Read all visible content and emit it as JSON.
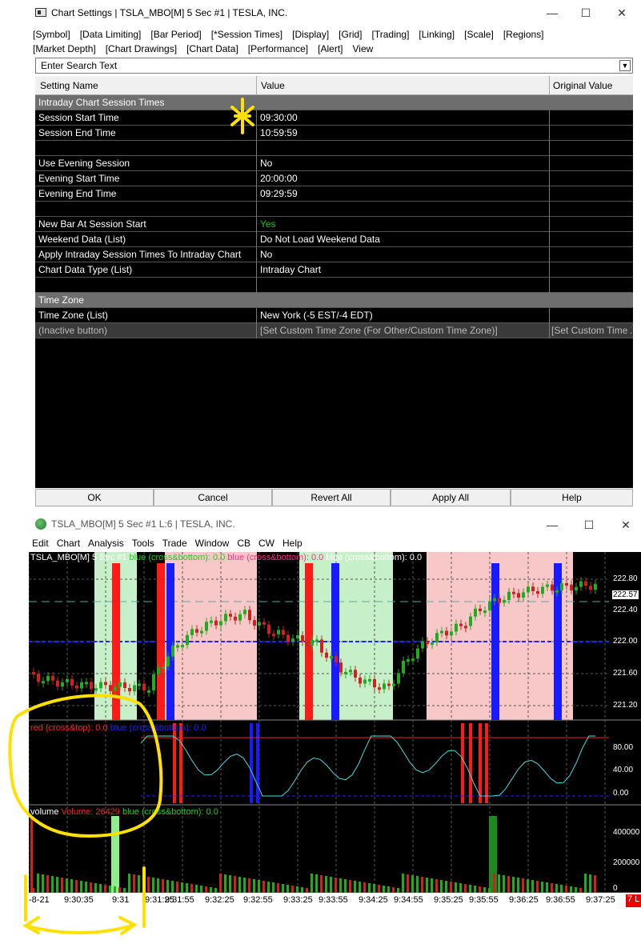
{
  "settings_window": {
    "title": "Chart Settings | TSLA_MBO[M]  5 Sec  #1 | TESLA, INC.",
    "controls": {
      "minimize": "—",
      "maximize": "☐",
      "close": "✕"
    },
    "menu_row1": [
      "[Symbol]",
      "[Data Limiting]",
      "[Bar Period]",
      "[*Session Times]",
      "[Display]",
      "[Grid]",
      "[Trading]",
      "[Linking]",
      "[Scale]",
      "[Regions]"
    ],
    "menu_row2": [
      "[Market Depth]",
      "[Chart Drawings]",
      "[Chart Data]",
      "[Performance]",
      "[Alert]",
      "View"
    ],
    "search_placeholder": "Enter Search Text",
    "columns": {
      "name": "Setting Name",
      "value": "Value",
      "original": "Original Value"
    },
    "rows": [
      {
        "name": "Intraday Chart Session Times",
        "value": "",
        "original": "",
        "type": "section"
      },
      {
        "name": "Session Start Time",
        "value": "09:30:00",
        "original": ""
      },
      {
        "name": "Session End Time",
        "value": "10:59:59",
        "original": ""
      },
      {
        "name": "",
        "value": "",
        "original": ""
      },
      {
        "name": "Use Evening Session",
        "value": "No",
        "original": ""
      },
      {
        "name": "Evening Start Time",
        "value": "20:00:00",
        "original": ""
      },
      {
        "name": "Evening End Time",
        "value": "09:29:59",
        "original": ""
      },
      {
        "name": "",
        "value": "",
        "original": ""
      },
      {
        "name": "New Bar At Session Start",
        "value": "Yes",
        "original": "",
        "value_color": "#22c322"
      },
      {
        "name": "Weekend Data (List)",
        "value": "Do Not Load Weekend Data",
        "original": ""
      },
      {
        "name": "Apply Intraday Session Times To Intraday Chart",
        "value": "No",
        "original": ""
      },
      {
        "name": "Chart Data Type (List)",
        "value": "Intraday Chart",
        "original": ""
      },
      {
        "name": "",
        "value": "",
        "original": ""
      },
      {
        "name": "Time Zone",
        "value": "",
        "original": "",
        "type": "section"
      },
      {
        "name": "Time Zone (List)",
        "value": "New York (-5 EST/-4 EDT)",
        "original": ""
      },
      {
        "name": " (Inactive button)",
        "value": "[Set Custom Time Zone (For Other/Custom Time Zone)]",
        "original": "[Set Custom Time Zone",
        "type": "inactive"
      }
    ],
    "buttons": {
      "ok": "OK",
      "cancel": "Cancel",
      "revert": "Revert All",
      "apply": "Apply All",
      "help": "Help"
    }
  },
  "chart_window": {
    "title": "TSLA_MBO[M]  5 Sec  #1 L:6 | TESLA, INC.",
    "controls": {
      "minimize": "—",
      "maximize": "☐",
      "close": "✕"
    },
    "menu": [
      "Edit",
      "Chart",
      "Analysis",
      "Tools",
      "Trade",
      "Window",
      "CB",
      "CW",
      "Help"
    ],
    "price_header": {
      "symbol": "TSLA_MBO[M]  5 Sec  #1",
      "s1": "blue (cross&bottom): 0.0",
      "s2": "blue (cross&bottom): 0.0",
      "s3": "blue (cross&bottom): 0.0"
    },
    "price_labels": [
      "222.80",
      "222.57",
      "222.40",
      "222.00",
      "221.60",
      "221.20"
    ],
    "current_price": "222.57",
    "osc_header": {
      "s1": "red (cross&top): 0.0",
      "s2": "blue (cross&bottom): 0.0"
    },
    "osc_labels": [
      "80.00",
      "40.00",
      "0.00"
    ],
    "volume_header": {
      "name": "volume",
      "vol": "Volume: 26429",
      "s2": "blue (cross&bottom): 0.0"
    },
    "volume_labels": [
      "400000",
      "200000",
      "0"
    ],
    "time_labels": [
      "-8-21",
      "9:30:35",
      "9:31",
      "9:31:25",
      "9:31:55",
      "9:32:25",
      "9:32:55",
      "9:33:25",
      "9:33:55",
      "9:34:25",
      "9:34:55",
      "9:35:25",
      "9:35:55",
      "9:36:25",
      "9:36:55",
      "9:37:25"
    ],
    "corner_badge": "7 L",
    "colors": {
      "green_zone": "#c8f0c8",
      "red_zone": "#f8c8c8",
      "up": "#22aa22",
      "down": "#cc2222",
      "blue_bar": "#1a1aff",
      "red_bar": "#ff1a1a"
    }
  }
}
